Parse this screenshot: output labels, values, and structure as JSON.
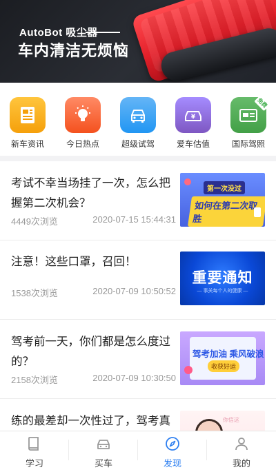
{
  "banner": {
    "brand": "AutoBot 吸尘器",
    "headline": "车内清洁无烦恼"
  },
  "quick_icons": [
    {
      "label": "新车资讯",
      "icon": "news-document-icon",
      "color": "#f9a825"
    },
    {
      "label": "今日热点",
      "icon": "lightbulb-icon",
      "color": "#ff7043"
    },
    {
      "label": "超级试驾",
      "icon": "car-front-icon",
      "color": "#42a5f5"
    },
    {
      "label": "爱车估值",
      "icon": "car-valuation-icon",
      "color": "#8e6cf0"
    },
    {
      "label": "国际驾照",
      "icon": "license-card-icon",
      "color": "#4caf50",
      "badge": "免费"
    }
  ],
  "news": [
    {
      "title": "考试不幸当场挂了一次，怎么把握第二次机会？",
      "views": "4449次浏览",
      "date": "2020-07-15 15:44:31",
      "thumb": {
        "line1": "第一次没过",
        "line2": "如何在第二次取胜"
      }
    },
    {
      "title": "注意！这些口罩，召回！",
      "views": "1538次浏览",
      "date": "2020-07-09 10:50:52",
      "thumb": {
        "line1": "重要通知",
        "line2": "— 事关每个人的健康 —"
      }
    },
    {
      "title": "驾考前一天，你们都是怎么度过的？",
      "views": "2158次浏览",
      "date": "2020-07-09 10:30:50",
      "thumb": {
        "line1": "驾考加油 乘风破浪",
        "line2": "收获好运"
      }
    },
    {
      "title": "练的最差却一次性过了，驾考真",
      "thumb": {
        "line1": "你信这"
      }
    }
  ],
  "tabbar": [
    {
      "label": "学习",
      "icon": "book-icon",
      "active": false
    },
    {
      "label": "买车",
      "icon": "car-icon",
      "active": false
    },
    {
      "label": "发现",
      "icon": "compass-icon",
      "active": true
    },
    {
      "label": "我的",
      "icon": "user-icon",
      "active": false
    }
  ],
  "colors": {
    "accent": "#2d7ff0",
    "muted": "#999999"
  }
}
